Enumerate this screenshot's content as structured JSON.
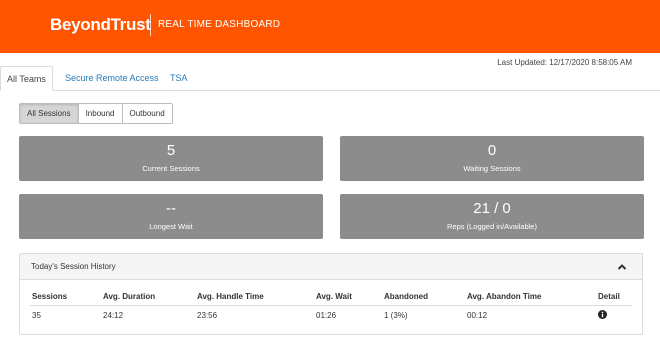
{
  "header": {
    "brand": "BeyondTrust",
    "subtitle": "REAL TIME DASHBOARD",
    "bg_color": "#ff5500"
  },
  "last_updated": "Last Updated: 12/17/2020 8:58:05 AM",
  "tabs": [
    {
      "label": "All Teams",
      "active": true
    },
    {
      "label": "Secure Remote Access",
      "active": false
    },
    {
      "label": "TSA",
      "active": false
    }
  ],
  "filters": [
    {
      "label": "All Sessions",
      "active": true
    },
    {
      "label": "Inbound",
      "active": false
    },
    {
      "label": "Outbound",
      "active": false
    }
  ],
  "cards": {
    "current_sessions": {
      "value": "5",
      "label": "Current Sessions"
    },
    "waiting_sessions": {
      "value": "0",
      "label": "Waiting Sessions"
    },
    "longest_wait": {
      "value": "--",
      "label": "Longest Wait"
    },
    "reps": {
      "value": "21 / 0",
      "label": "Reps (Logged in/Available)"
    }
  },
  "history": {
    "title": "Today's Session History",
    "collapse_icon": "chevron-up-icon",
    "columns": [
      "Sessions",
      "Avg. Duration",
      "Avg. Handle Time",
      "Avg. Wait",
      "Abandoned",
      "Avg. Abandon Time",
      "Detail"
    ],
    "rows": [
      [
        "35",
        "24:12",
        "23:56",
        "01:26",
        "1 (3%)",
        "00:12"
      ]
    ],
    "detail_icon": "info-icon"
  }
}
